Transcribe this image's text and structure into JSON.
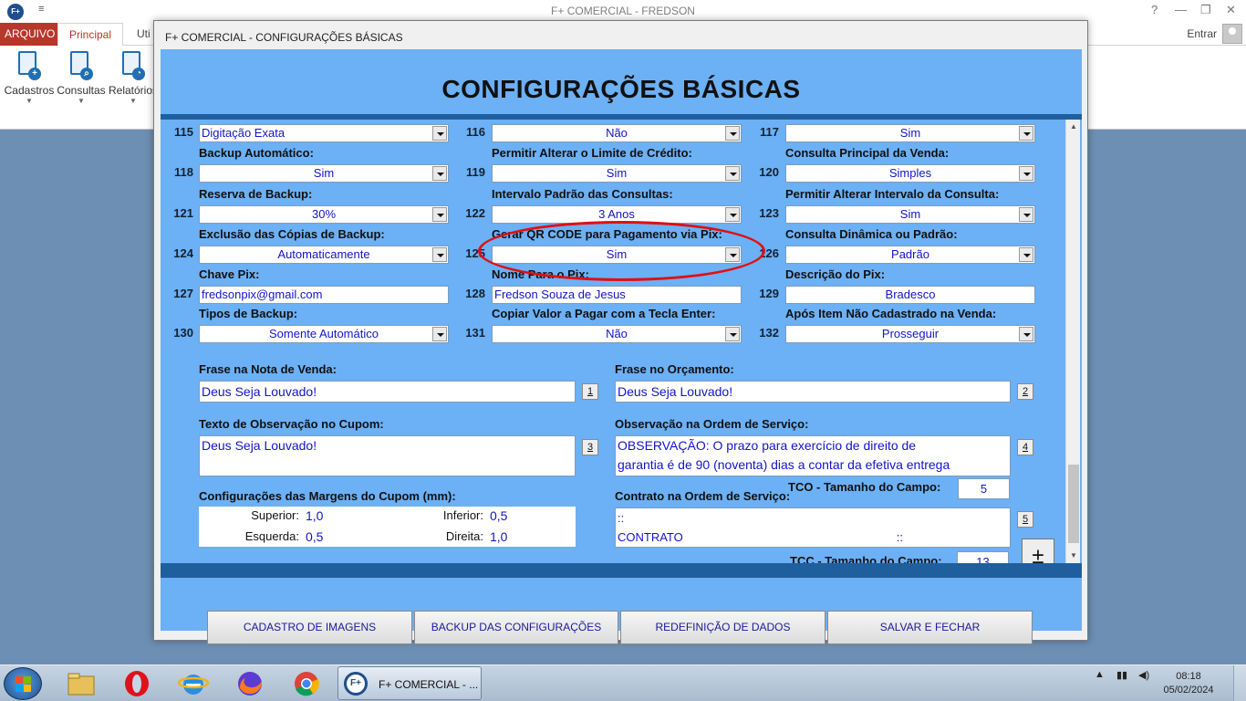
{
  "app": {
    "logo": "F+",
    "qat_icon": "≡",
    "title": "F+ COMERCIAL - FREDSON",
    "help": "?",
    "minimize": "—",
    "restore": "❐",
    "close": "✕",
    "tabs": {
      "arquivo": "ARQUIVO",
      "principal": "Principal",
      "util": "Uti"
    },
    "login": "Entrar",
    "ribbon": [
      {
        "label": "Cadastros",
        "icon": "cadastros-icon",
        "badge": "+"
      },
      {
        "label": "Consultas",
        "icon": "consultas-icon",
        "badge": "⌕"
      },
      {
        "label": "Relatórios",
        "icon": "relatorios-icon",
        "badge": "◔"
      }
    ]
  },
  "dialog": {
    "title": "F+ COMERCIAL - CONFIGURAÇÕES BÁSICAS",
    "heading": "CONFIGURAÇÕES BÁSICAS",
    "settings": [
      {
        "num": "115",
        "label": "",
        "value": "Digitação Exata",
        "kind": "combo-left"
      },
      {
        "num": "116",
        "label": "",
        "value": "Não",
        "kind": "combo"
      },
      {
        "num": "117",
        "label": "",
        "value": "Sim",
        "kind": "combo"
      },
      {
        "num": "118",
        "label": "Backup Automático:",
        "value": "Sim",
        "kind": "combo"
      },
      {
        "num": "119",
        "label": "Permitir Alterar o Limite de Crédito:",
        "value": "Sim",
        "kind": "combo"
      },
      {
        "num": "120",
        "label": "Consulta Principal da Venda:",
        "value": "Simples",
        "kind": "combo"
      },
      {
        "num": "121",
        "label": "Reserva de Backup:",
        "value": "30%",
        "kind": "combo"
      },
      {
        "num": "122",
        "label": "Intervalo Padrão das Consultas:",
        "value": "3 Anos",
        "kind": "combo"
      },
      {
        "num": "123",
        "label": "Permitir Alterar Intervalo da Consulta:",
        "value": "Sim",
        "kind": "combo"
      },
      {
        "num": "124",
        "label": "Exclusão das Cópias de Backup:",
        "value": "Automaticamente",
        "kind": "combo"
      },
      {
        "num": "125",
        "label": "Gerar QR CODE para Pagamento via Pix:",
        "value": "Sim",
        "kind": "combo"
      },
      {
        "num": "126",
        "label": "Consulta Dinâmica ou Padrão:",
        "value": "Padrão",
        "kind": "combo"
      },
      {
        "num": "127",
        "label": "Chave Pix:",
        "value": "fredsonpix@gmail.com",
        "kind": "text"
      },
      {
        "num": "128",
        "label": "Nome Para o Pix:",
        "value": "Fredson Souza de Jesus",
        "kind": "text"
      },
      {
        "num": "129",
        "label": "Descrição do Pix:",
        "value": "Bradesco",
        "kind": "text-center"
      },
      {
        "num": "130",
        "label": "Tipos de Backup:",
        "value": "Somente Automático",
        "kind": "combo"
      },
      {
        "num": "131",
        "label": "Copiar Valor a Pagar com a Tecla Enter:",
        "value": "Não",
        "kind": "combo"
      },
      {
        "num": "132",
        "label": "Após Item Não Cadastrado na Venda:",
        "value": "Prosseguir",
        "kind": "combo"
      }
    ],
    "phrases": {
      "nota_label": "Frase na Nota de Venda:",
      "nota_value": "Deus Seja Louvado!",
      "nota_btn": "1",
      "orcamento_label": "Frase no Orçamento:",
      "orcamento_value": "Deus Seja Louvado!",
      "orcamento_btn": "2",
      "cupom_label": "Texto de Observação no Cupom:",
      "cupom_value": "Deus Seja Louvado!",
      "cupom_btn": "3",
      "os_label": "Observação na Ordem de Serviço:",
      "os_line1": "OBSERVAÇÃO: O prazo para exercício de direito de",
      "os_line2": "garantia é de 90 (noventa) dias a contar da efetiva entrega",
      "os_btn": "4",
      "tco_label": "TCO - Tamanho do Campo:",
      "tco_value": "5",
      "contrato_label": "Contrato na Ordem de Serviço:",
      "contrato_line1": "::",
      "contrato_line2": "CONTRATO",
      "contrato_line2b": "::",
      "contrato_btn": "5",
      "tcc_label": "TCC - Tamanho do Campo:",
      "tcc_value": "13"
    },
    "margins": {
      "title": "Configurações das Margens do Cupom (mm):",
      "superior_label": "Superior:",
      "superior_value": "1,0",
      "inferior_label": "Inferior:",
      "inferior_value": "0,5",
      "esquerda_label": "Esquerda:",
      "esquerda_value": "0,5",
      "direita_label": "Direita:",
      "direita_value": "1,0"
    },
    "plus": "±",
    "buttons": [
      {
        "label": "CADASTRO DE IMAGENS"
      },
      {
        "label": "BACKUP DAS CONFIGURAÇÕES"
      },
      {
        "label": "REDEFINIÇÃO DE DADOS"
      },
      {
        "label": "SALVAR E FECHAR"
      }
    ]
  },
  "taskbar": {
    "task_label": "F+ COMERCIAL - ...",
    "task_logo": "F+",
    "time": "08:18",
    "date": "05/02/2024"
  },
  "colors": {
    "dialog_body": "#6cb0f5",
    "value_text": "#1414c8",
    "separator": "#1f5f9e",
    "highlight_ring": "#e01010",
    "arquivo_tab": "#b7372b"
  }
}
